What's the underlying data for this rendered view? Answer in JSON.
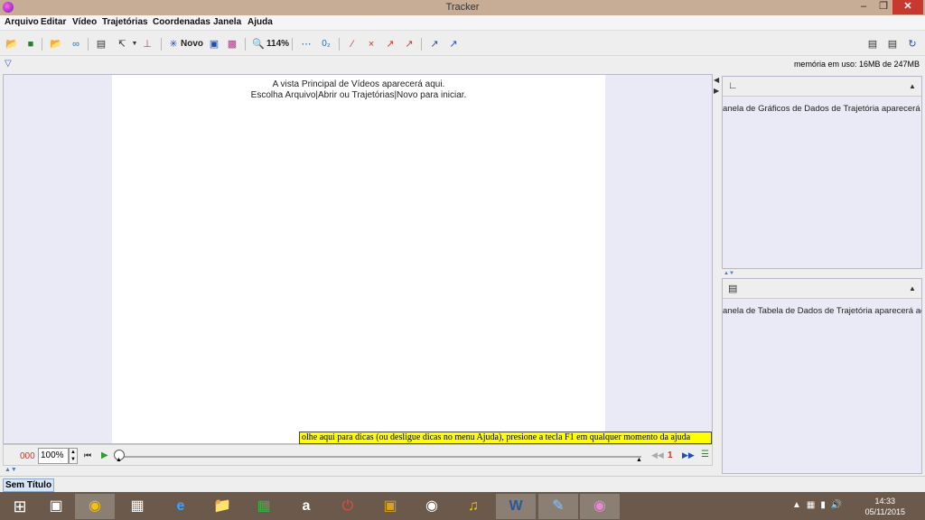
{
  "window": {
    "title": "Tracker",
    "controls": {
      "minimize": "–",
      "restore": "❐",
      "close": "✕"
    }
  },
  "menu": [
    "Arquivo",
    "Editar",
    "Vídeo",
    "Trajetórias",
    "Coordenadas",
    "Janela",
    "Ajuda"
  ],
  "toolbar": {
    "new_label": "Novo",
    "zoom_label": "114%"
  },
  "status": {
    "memory": "memória em uso: 16MB de 247MB"
  },
  "video": {
    "line1": "A vista Principal de Vídeos aparecerá aqui.",
    "line2": "Escolha Arquivo|Abrir ou Trajetórias|Novo para iniciar."
  },
  "hint": "olhe aqui para dicas (ou desligue dicas no menu Ajuda), presione a tecla F1 em qualquer momento da ajuda",
  "player": {
    "frame": "000",
    "zoom": "100%",
    "step_value": "1"
  },
  "right_panel": {
    "plot_msg": "anela de Gráficos de Dados de Trajetória aparecerá aqui.",
    "table_msg": "anela de Tabela de Dados de Trajetória aparecerá aqui."
  },
  "tab": {
    "label": "Sem Título"
  },
  "taskbar": {
    "time": "14:33",
    "date": "05/11/2015"
  },
  "colors": {
    "titlebar": "#c7ac96",
    "hint_bg": "#ffff00",
    "frame_counter": "#c0392b",
    "pane_bg": "#eaeaf7"
  }
}
